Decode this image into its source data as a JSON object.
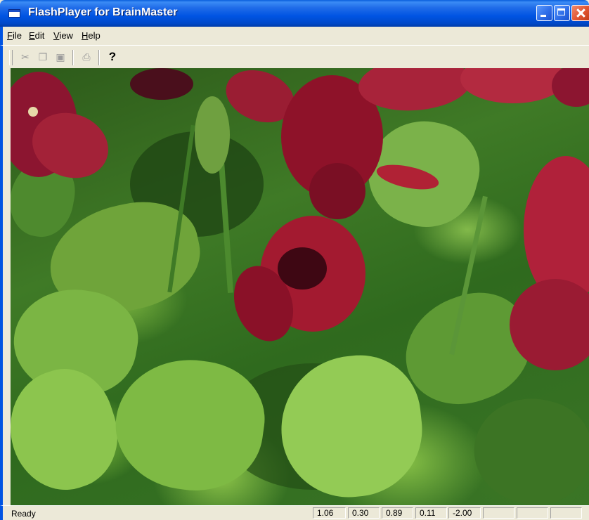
{
  "window": {
    "title": "FlashPlayer for BrainMaster"
  },
  "menu": {
    "items": [
      {
        "key": "F",
        "rest": "ile"
      },
      {
        "key": "E",
        "rest": "dit"
      },
      {
        "key": "V",
        "rest": "iew"
      },
      {
        "key": "H",
        "rest": "elp"
      }
    ]
  },
  "toolbar": {
    "cut_icon": "✂",
    "copy_icon": "❐",
    "paste_icon": "▣",
    "print_icon": "⎙",
    "help_icon": "?"
  },
  "photo": {
    "icon": "flowers-photo"
  },
  "status": {
    "text": "Ready",
    "values": [
      "1.06",
      "0.30",
      "0.89",
      "0.11",
      "-2.00",
      "",
      "",
      ""
    ]
  }
}
